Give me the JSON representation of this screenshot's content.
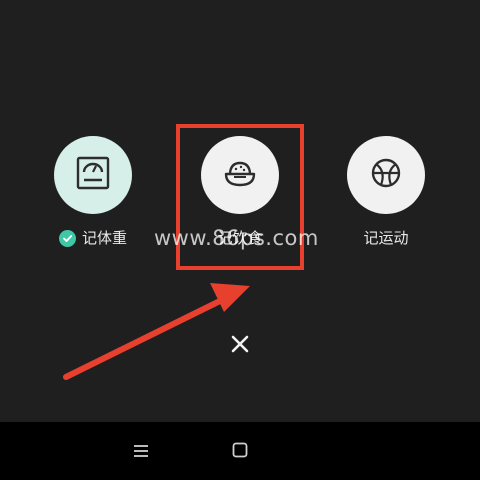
{
  "actions": [
    {
      "label": "记体重",
      "icon": "scale-icon",
      "checked": true
    },
    {
      "label": "记饮食",
      "icon": "rice-bowl-icon",
      "checked": false
    },
    {
      "label": "记运动",
      "icon": "basketball-icon",
      "checked": false
    }
  ],
  "watermark": "www.86ps.com",
  "colors": {
    "scale_bg": "#d6efe9",
    "food_bg": "#f1f1f1",
    "sport_bg": "#f1f1f1",
    "check": "#41c7a6",
    "highlight": "#e8402f"
  },
  "nav": [
    "menu-icon",
    "home-square-icon"
  ]
}
